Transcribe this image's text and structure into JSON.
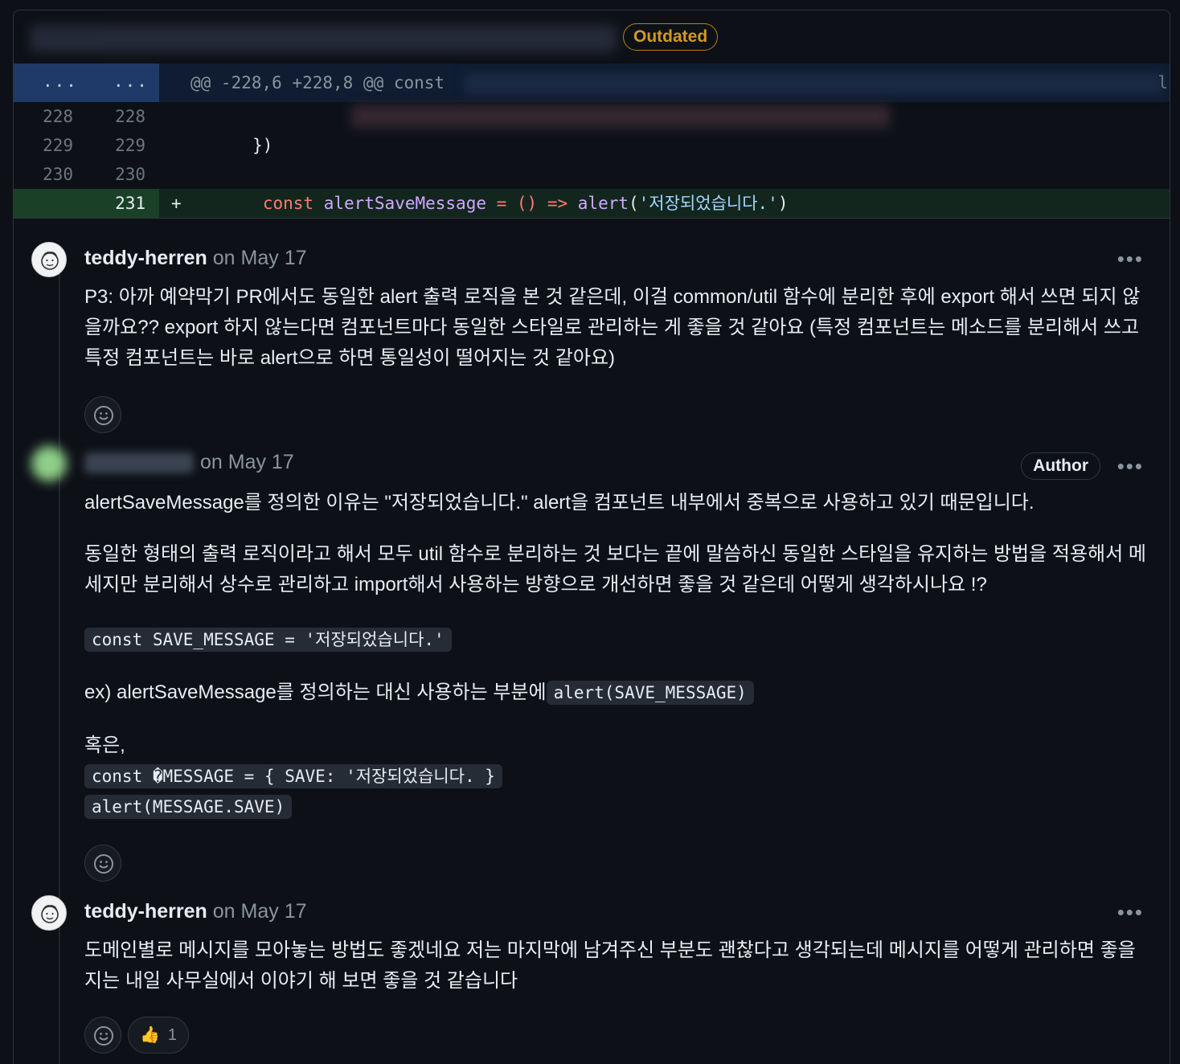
{
  "file_header": {
    "status_badge": "Outdated"
  },
  "diff": {
    "hunk": {
      "left_dots": "...",
      "right_dots": "...",
      "header": "@@ -228,6 +228,8 @@ const",
      "trailing": "l"
    },
    "rows": [
      {
        "old": "228",
        "new": "228",
        "code": ""
      },
      {
        "old": "229",
        "new": "229",
        "code": "        })"
      },
      {
        "old": "230",
        "new": "230",
        "code": ""
      }
    ],
    "added_row": {
      "new": "231",
      "sign": "+",
      "indent": "        ",
      "kw": "const",
      "name": "alertSaveMessage",
      "op": " = () => ",
      "fn": "alert",
      "open": "(",
      "str": "'저장되었습니다.'",
      "close": ")"
    }
  },
  "comments": [
    {
      "author": "teddy-herren",
      "date": "on May 17",
      "body": "P3: 아까 예약막기 PR에서도 동일한 alert 출력 로직을 본 것 같은데, 이걸 common/util 함수에 분리한 후에 export 해서 쓰면 되지 않을까요?? export 하지 않는다면 컴포넌트마다 동일한 스타일로 관리하는 게 좋을 것 같아요 (특정 컴포넌트는 메소드를 분리해서 쓰고 특정 컴포넌트는 바로 alert으로 하면 통일성이 떨어지는 것 같아요)"
    },
    {
      "date": "on May 17",
      "badge": "Author",
      "p1": "alertSaveMessage를 정의한 이유는 \"저장되었습니다.\" alert을 컴포넌트 내부에서 중복으로 사용하고 있기 때문입니다.",
      "p2": "동일한 형태의 출력 로직이라고 해서 모두 util 함수로 분리하는 것 보다는 끝에 말씀하신 동일한 스타일을 유지하는 방법을 적용해서 메세지만 분리해서 상수로 관리하고 import해서 사용하는 방향으로 개선하면 좋을 것 같은데 어떻게 생각하시나요 !?",
      "code1": "const SAVE_MESSAGE = '저장되었습니다.'",
      "ex_text": "ex) alertSaveMessage를 정의하는 대신 사용하는 부분에",
      "ex_code": "alert(SAVE_MESSAGE)",
      "or_text": "혹은,",
      "code2": "const �MESSAGE = { SAVE: '저장되었습니다. }",
      "code3": "alert(MESSAGE.SAVE)"
    },
    {
      "author": "teddy-herren",
      "date": "on May 17",
      "body": "도메인별로 메시지를 모아놓는 방법도 좋겠네요 저는 마지막에 남겨주신 부분도 괜찮다고 생각되는데 메시지를 어떻게 관리하면 좋을지는 내일 사무실에서 이야기 해 보면 좋을 것 같습니다",
      "reaction_count": "1"
    }
  ],
  "more_label": "•••"
}
